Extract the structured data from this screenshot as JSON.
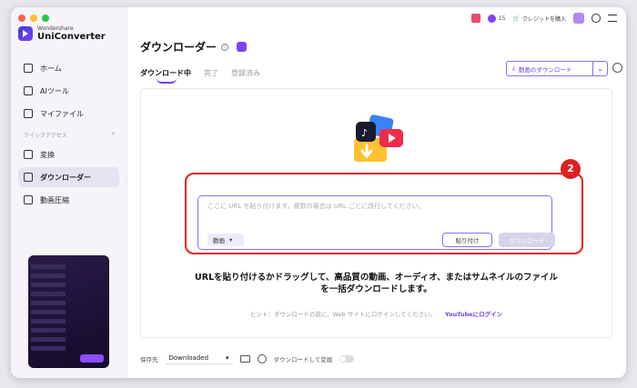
{
  "app": {
    "brand_small": "Wondershare",
    "brand_big": "UniConverter"
  },
  "topbar": {
    "credits": "15",
    "buy_credits": "クレジットを購入"
  },
  "sidebar": {
    "items": [
      {
        "label": "ホーム",
        "icon": "home-icon"
      },
      {
        "label": "AIツール",
        "icon": "ai-tools-icon"
      },
      {
        "label": "マイファイル",
        "icon": "my-files-icon"
      }
    ],
    "quick_access_label": "クイックアクセス",
    "quick_items": [
      {
        "label": "変換",
        "icon": "convert-icon"
      },
      {
        "label": "ダウンローダー",
        "icon": "downloader-icon",
        "active": true
      },
      {
        "label": "動画圧縮",
        "icon": "compress-icon"
      }
    ]
  },
  "page": {
    "title": "ダウンローダー",
    "tabs": [
      "ダウンロード中",
      "完了",
      "登録済み"
    ],
    "download_video_btn": "動画のダウンロード"
  },
  "input": {
    "placeholder": "ここに URL を貼り付けます。複数の場合は URL ごとに改行してください。",
    "type_label": "動画",
    "paste_label": "貼り付け",
    "download_label": "ダウンロード"
  },
  "annotation": {
    "step": "2"
  },
  "instructions": {
    "line1": "URLを貼り付けるかドラッグして、高品質の動画、オーディオ、またはサムネイルのファイル",
    "line2": "を一括ダウンロードします。",
    "hint": "ヒント：ダウンロードの前に、Web サイトにログインしてください。",
    "hint_link": "YouTubeにログイン"
  },
  "footer": {
    "save_label": "保存先",
    "save_value": "Downloaded",
    "convert_label": "ダウンロードして変換"
  }
}
